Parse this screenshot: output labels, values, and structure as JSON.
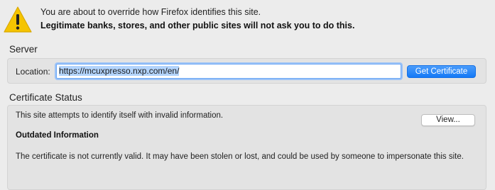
{
  "warning": {
    "icon": "warning-icon",
    "line1": "You are about to override how Firefox identifies this site.",
    "line2": "Legitimate banks, stores, and other public sites will not ask you to do this."
  },
  "server": {
    "title": "Server",
    "location_label": "Location:",
    "location_value": "https://mcuxpresso.nxp.com/en/",
    "get_certificate_label": "Get Certificate"
  },
  "certificate_status": {
    "title": "Certificate Status",
    "status_text": "This site attempts to identify itself with invalid information.",
    "view_label": "View...",
    "issue_heading": "Outdated Information",
    "issue_detail": "The certificate is not currently valid. It may have been stolen or lost, and could be used by someone to impersonate this site."
  },
  "colors": {
    "accent": "#1479f6",
    "warning": "#f5c400"
  }
}
